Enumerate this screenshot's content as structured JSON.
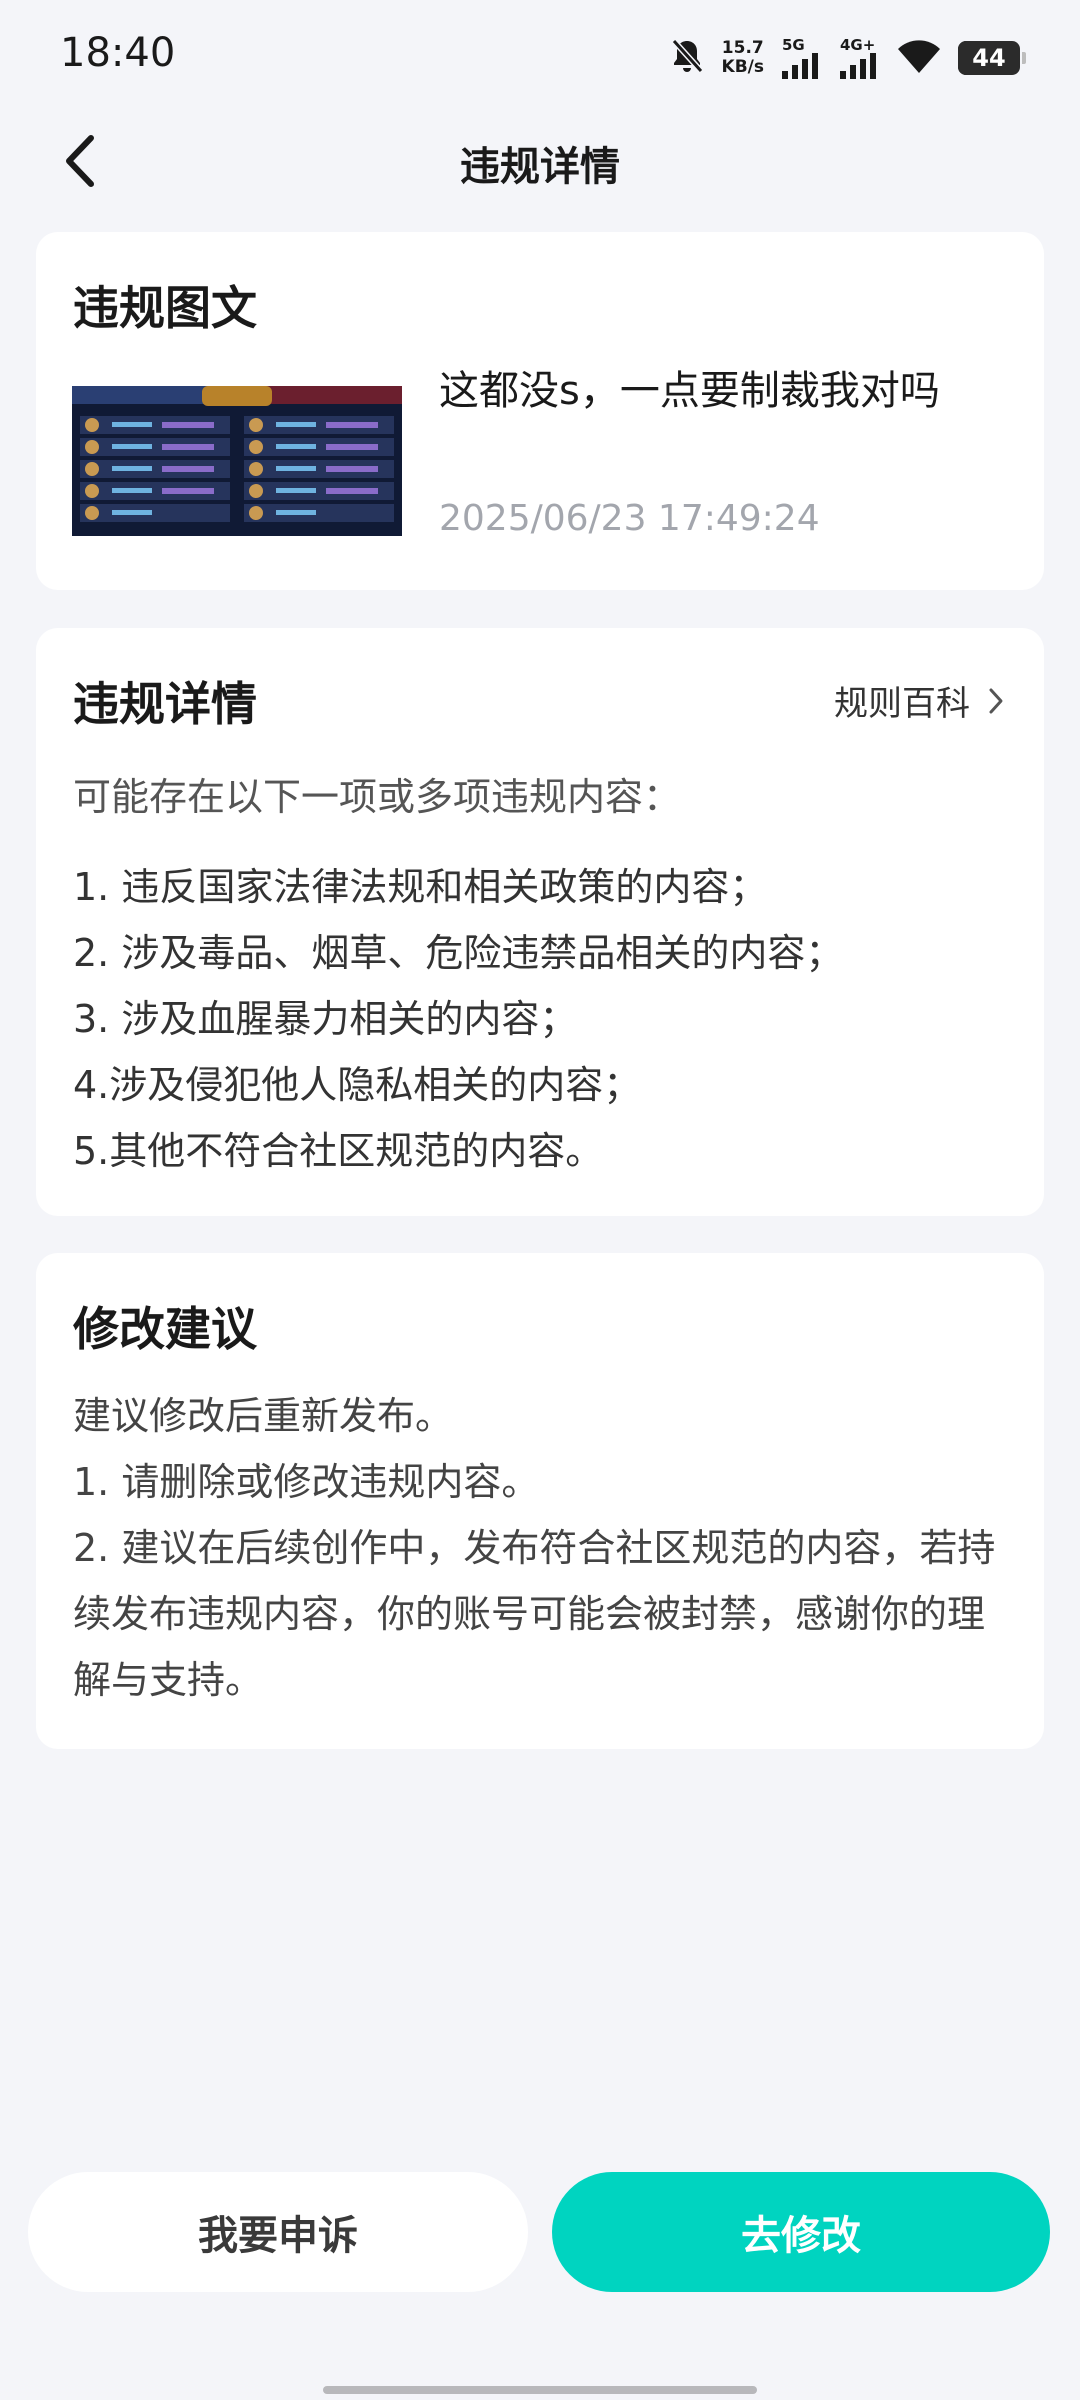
{
  "status_bar": {
    "time": "18:40",
    "speed_value": "15.7",
    "speed_unit": "KB/s",
    "net1": "5G",
    "net2": "4G+",
    "battery": "44",
    "icons": [
      "mute-bell-icon",
      "signal-icon",
      "wifi-icon",
      "battery-icon"
    ]
  },
  "header": {
    "title": "违规详情",
    "back_icon": "chevron-left-icon"
  },
  "post_card": {
    "title": "违规图文",
    "text": "这都没s，一点要制裁我对吗",
    "timestamp": "2025/06/23 17:49:24"
  },
  "violation_card": {
    "title": "违规详情",
    "link_label": "规则百科",
    "intro": "可能存在以下一项或多项违规内容：",
    "items": [
      "1. 违反国家法律法规和相关政策的内容；",
      "2. 涉及毒品、烟草、危险违禁品相关的内容；",
      "3. 涉及血腥暴力相关的内容；",
      "4.涉及侵犯他人隐私相关的内容；",
      "5.其他不符合社区规范的内容。"
    ]
  },
  "suggestion_card": {
    "title": "修改建议",
    "lines": [
      "建议修改后重新发布。",
      "1. 请删除或修改违规内容。",
      "2. 建议在后续创作中，发布符合社区规范的内容，若持续发布违规内容，你的账号可能会被封禁，感谢你的理解与支持。"
    ]
  },
  "buttons": {
    "appeal": "我要申诉",
    "modify": "去修改"
  },
  "colors": {
    "accent": "#00d4c0",
    "background": "#f4f5f9",
    "timestamp": "#a3a6ad"
  }
}
